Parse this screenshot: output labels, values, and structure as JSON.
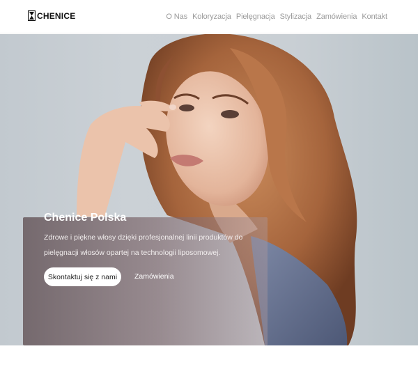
{
  "brand": {
    "name": "CHENICE",
    "logo_icon": "hourglass-logo-icon"
  },
  "nav": {
    "items": [
      {
        "label": "O Nas"
      },
      {
        "label": "Koloryzacja"
      },
      {
        "label": "Pielęgnacja"
      },
      {
        "label": "Stylizacja"
      },
      {
        "label": "Zamówienia"
      },
      {
        "label": "Kontakt"
      }
    ]
  },
  "hero": {
    "title": "Chenice Polska",
    "text": "Zdrowe i piękne włosy dzięki profesjonalnej linii produktów do pielęgnacji włosów opartej na technologii liposomowej.",
    "primary_button": "Skontaktuj się z nami",
    "secondary_link": "Zamówienia"
  },
  "colors": {
    "nav_text": "#9a9a9a",
    "hair": "#a5643c",
    "skin": "#e8bfa6",
    "overlay": "#5f4e52"
  }
}
